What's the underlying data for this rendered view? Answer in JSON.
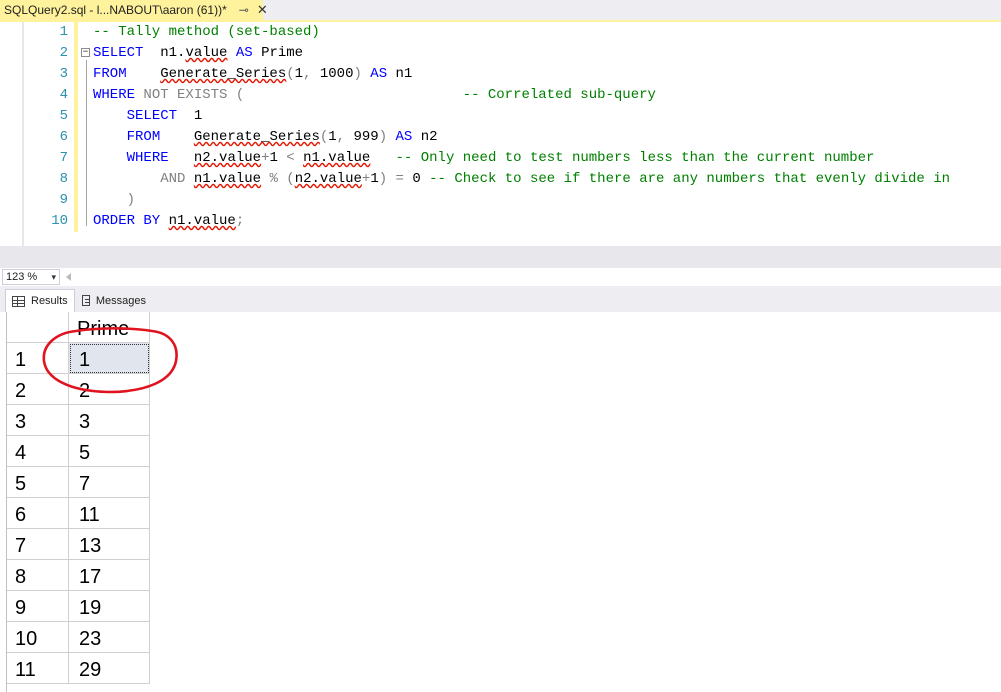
{
  "document_tab": {
    "title": "SQLQuery2.sql - l...NABOUT\\aaron (61))*",
    "pin_icon": "pin-icon",
    "close_glyph": "✕"
  },
  "editor": {
    "line_numbers": [
      "1",
      "2",
      "3",
      "4",
      "5",
      "6",
      "7",
      "8",
      "9",
      "10"
    ],
    "outline_glyph": "−",
    "lines": [
      [
        {
          "t": "-- Tally method (set-based)",
          "c": "cm"
        }
      ],
      [
        {
          "t": "SELECT",
          "c": "kw"
        },
        {
          "t": "  n1.",
          "c": ""
        },
        {
          "t": "value",
          "c": "sq"
        },
        {
          "t": " ",
          "c": ""
        },
        {
          "t": "AS",
          "c": "kw"
        },
        {
          "t": " Prime",
          "c": ""
        }
      ],
      [
        {
          "t": "FROM",
          "c": "kw"
        },
        {
          "t": "    ",
          "c": ""
        },
        {
          "t": "Generate_Series",
          "c": "sq"
        },
        {
          "t": "(",
          "c": "gr"
        },
        {
          "t": "1",
          "c": ""
        },
        {
          "t": ", ",
          "c": "gr"
        },
        {
          "t": "1000",
          "c": ""
        },
        {
          "t": ") ",
          "c": "gr"
        },
        {
          "t": "AS",
          "c": "kw"
        },
        {
          "t": " n1",
          "c": ""
        }
      ],
      [
        {
          "t": "WHERE",
          "c": "kw"
        },
        {
          "t": " NOT EXISTS (",
          "c": "gr"
        },
        {
          "t": "                          ",
          "c": ""
        },
        {
          "t": "-- Correlated sub-query",
          "c": "cm"
        }
      ],
      [
        {
          "t": "    ",
          "c": ""
        },
        {
          "t": "SELECT",
          "c": "kw"
        },
        {
          "t": "  1",
          "c": ""
        }
      ],
      [
        {
          "t": "    ",
          "c": ""
        },
        {
          "t": "FROM",
          "c": "kw"
        },
        {
          "t": "    ",
          "c": ""
        },
        {
          "t": "Generate_Series",
          "c": "sq"
        },
        {
          "t": "(",
          "c": "gr"
        },
        {
          "t": "1",
          "c": ""
        },
        {
          "t": ", ",
          "c": "gr"
        },
        {
          "t": "999",
          "c": ""
        },
        {
          "t": ") ",
          "c": "gr"
        },
        {
          "t": "AS",
          "c": "kw"
        },
        {
          "t": " n2",
          "c": ""
        }
      ],
      [
        {
          "t": "    ",
          "c": ""
        },
        {
          "t": "WHERE",
          "c": "kw"
        },
        {
          "t": "   ",
          "c": ""
        },
        {
          "t": "n2.value",
          "c": "sq"
        },
        {
          "t": "+",
          "c": "gr"
        },
        {
          "t": "1 ",
          "c": ""
        },
        {
          "t": "<",
          "c": "gr"
        },
        {
          "t": " ",
          "c": ""
        },
        {
          "t": "n1.value",
          "c": "sq"
        },
        {
          "t": "   ",
          "c": ""
        },
        {
          "t": "-- Only need to test numbers less than the current number",
          "c": "cm"
        }
      ],
      [
        {
          "t": "        ",
          "c": ""
        },
        {
          "t": "AND",
          "c": "gr"
        },
        {
          "t": " ",
          "c": ""
        },
        {
          "t": "n1.value",
          "c": "sq"
        },
        {
          "t": " % ",
          "c": "gr"
        },
        {
          "t": "(",
          "c": "gr"
        },
        {
          "t": "n2.value",
          "c": "sq"
        },
        {
          "t": "+",
          "c": "gr"
        },
        {
          "t": "1",
          "c": ""
        },
        {
          "t": ") ",
          "c": "gr"
        },
        {
          "t": "=",
          "c": "gr"
        },
        {
          "t": " 0 ",
          "c": ""
        },
        {
          "t": "-- Check to see if there are any numbers that evenly divide in",
          "c": "cm"
        }
      ],
      [
        {
          "t": "    ",
          "c": ""
        },
        {
          "t": ")",
          "c": "gr"
        }
      ],
      [
        {
          "t": "ORDER BY",
          "c": "kw"
        },
        {
          "t": " ",
          "c": ""
        },
        {
          "t": "n1.value",
          "c": "sq"
        },
        {
          "t": ";",
          "c": "gr"
        }
      ]
    ]
  },
  "zoom": {
    "value": "123 %",
    "caret": "▾"
  },
  "results_tabs": [
    {
      "label": "Results",
      "icon": "grid-icon",
      "active": true
    },
    {
      "label": "Messages",
      "icon": "messages-icon",
      "active": false
    }
  ],
  "grid": {
    "column_header": "Prime",
    "rows": [
      {
        "num": "1",
        "value": "1",
        "selected": true
      },
      {
        "num": "2",
        "value": "2"
      },
      {
        "num": "3",
        "value": "3"
      },
      {
        "num": "4",
        "value": "5"
      },
      {
        "num": "5",
        "value": "7"
      },
      {
        "num": "6",
        "value": "11"
      },
      {
        "num": "7",
        "value": "13"
      },
      {
        "num": "8",
        "value": "17"
      },
      {
        "num": "9",
        "value": "19"
      },
      {
        "num": "10",
        "value": "23"
      },
      {
        "num": "11",
        "value": "29"
      }
    ]
  },
  "annotation": {
    "color": "#e0141e",
    "shape": "hand-drawn-circle"
  }
}
